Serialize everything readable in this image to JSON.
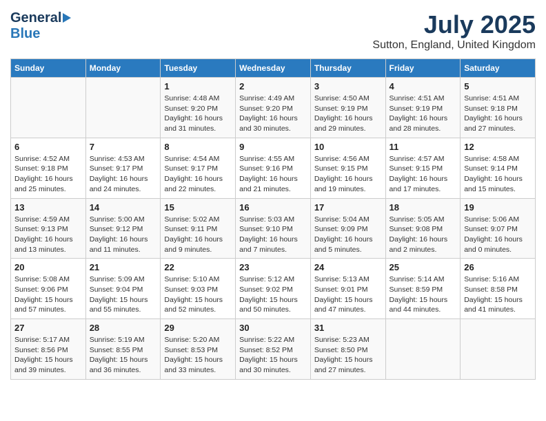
{
  "logo": {
    "general": "General",
    "blue": "Blue"
  },
  "title": "July 2025",
  "subtitle": "Sutton, England, United Kingdom",
  "columns": [
    "Sunday",
    "Monday",
    "Tuesday",
    "Wednesday",
    "Thursday",
    "Friday",
    "Saturday"
  ],
  "weeks": [
    {
      "days": [
        {
          "number": "",
          "info": ""
        },
        {
          "number": "",
          "info": ""
        },
        {
          "number": "1",
          "info": "Sunrise: 4:48 AM\nSunset: 9:20 PM\nDaylight: 16 hours\nand 31 minutes."
        },
        {
          "number": "2",
          "info": "Sunrise: 4:49 AM\nSunset: 9:20 PM\nDaylight: 16 hours\nand 30 minutes."
        },
        {
          "number": "3",
          "info": "Sunrise: 4:50 AM\nSunset: 9:19 PM\nDaylight: 16 hours\nand 29 minutes."
        },
        {
          "number": "4",
          "info": "Sunrise: 4:51 AM\nSunset: 9:19 PM\nDaylight: 16 hours\nand 28 minutes."
        },
        {
          "number": "5",
          "info": "Sunrise: 4:51 AM\nSunset: 9:18 PM\nDaylight: 16 hours\nand 27 minutes."
        }
      ]
    },
    {
      "days": [
        {
          "number": "6",
          "info": "Sunrise: 4:52 AM\nSunset: 9:18 PM\nDaylight: 16 hours\nand 25 minutes."
        },
        {
          "number": "7",
          "info": "Sunrise: 4:53 AM\nSunset: 9:17 PM\nDaylight: 16 hours\nand 24 minutes."
        },
        {
          "number": "8",
          "info": "Sunrise: 4:54 AM\nSunset: 9:17 PM\nDaylight: 16 hours\nand 22 minutes."
        },
        {
          "number": "9",
          "info": "Sunrise: 4:55 AM\nSunset: 9:16 PM\nDaylight: 16 hours\nand 21 minutes."
        },
        {
          "number": "10",
          "info": "Sunrise: 4:56 AM\nSunset: 9:15 PM\nDaylight: 16 hours\nand 19 minutes."
        },
        {
          "number": "11",
          "info": "Sunrise: 4:57 AM\nSunset: 9:15 PM\nDaylight: 16 hours\nand 17 minutes."
        },
        {
          "number": "12",
          "info": "Sunrise: 4:58 AM\nSunset: 9:14 PM\nDaylight: 16 hours\nand 15 minutes."
        }
      ]
    },
    {
      "days": [
        {
          "number": "13",
          "info": "Sunrise: 4:59 AM\nSunset: 9:13 PM\nDaylight: 16 hours\nand 13 minutes."
        },
        {
          "number": "14",
          "info": "Sunrise: 5:00 AM\nSunset: 9:12 PM\nDaylight: 16 hours\nand 11 minutes."
        },
        {
          "number": "15",
          "info": "Sunrise: 5:02 AM\nSunset: 9:11 PM\nDaylight: 16 hours\nand 9 minutes."
        },
        {
          "number": "16",
          "info": "Sunrise: 5:03 AM\nSunset: 9:10 PM\nDaylight: 16 hours\nand 7 minutes."
        },
        {
          "number": "17",
          "info": "Sunrise: 5:04 AM\nSunset: 9:09 PM\nDaylight: 16 hours\nand 5 minutes."
        },
        {
          "number": "18",
          "info": "Sunrise: 5:05 AM\nSunset: 9:08 PM\nDaylight: 16 hours\nand 2 minutes."
        },
        {
          "number": "19",
          "info": "Sunrise: 5:06 AM\nSunset: 9:07 PM\nDaylight: 16 hours\nand 0 minutes."
        }
      ]
    },
    {
      "days": [
        {
          "number": "20",
          "info": "Sunrise: 5:08 AM\nSunset: 9:06 PM\nDaylight: 15 hours\nand 57 minutes."
        },
        {
          "number": "21",
          "info": "Sunrise: 5:09 AM\nSunset: 9:04 PM\nDaylight: 15 hours\nand 55 minutes."
        },
        {
          "number": "22",
          "info": "Sunrise: 5:10 AM\nSunset: 9:03 PM\nDaylight: 15 hours\nand 52 minutes."
        },
        {
          "number": "23",
          "info": "Sunrise: 5:12 AM\nSunset: 9:02 PM\nDaylight: 15 hours\nand 50 minutes."
        },
        {
          "number": "24",
          "info": "Sunrise: 5:13 AM\nSunset: 9:01 PM\nDaylight: 15 hours\nand 47 minutes."
        },
        {
          "number": "25",
          "info": "Sunrise: 5:14 AM\nSunset: 8:59 PM\nDaylight: 15 hours\nand 44 minutes."
        },
        {
          "number": "26",
          "info": "Sunrise: 5:16 AM\nSunset: 8:58 PM\nDaylight: 15 hours\nand 41 minutes."
        }
      ]
    },
    {
      "days": [
        {
          "number": "27",
          "info": "Sunrise: 5:17 AM\nSunset: 8:56 PM\nDaylight: 15 hours\nand 39 minutes."
        },
        {
          "number": "28",
          "info": "Sunrise: 5:19 AM\nSunset: 8:55 PM\nDaylight: 15 hours\nand 36 minutes."
        },
        {
          "number": "29",
          "info": "Sunrise: 5:20 AM\nSunset: 8:53 PM\nDaylight: 15 hours\nand 33 minutes."
        },
        {
          "number": "30",
          "info": "Sunrise: 5:22 AM\nSunset: 8:52 PM\nDaylight: 15 hours\nand 30 minutes."
        },
        {
          "number": "31",
          "info": "Sunrise: 5:23 AM\nSunset: 8:50 PM\nDaylight: 15 hours\nand 27 minutes."
        },
        {
          "number": "",
          "info": ""
        },
        {
          "number": "",
          "info": ""
        }
      ]
    }
  ]
}
